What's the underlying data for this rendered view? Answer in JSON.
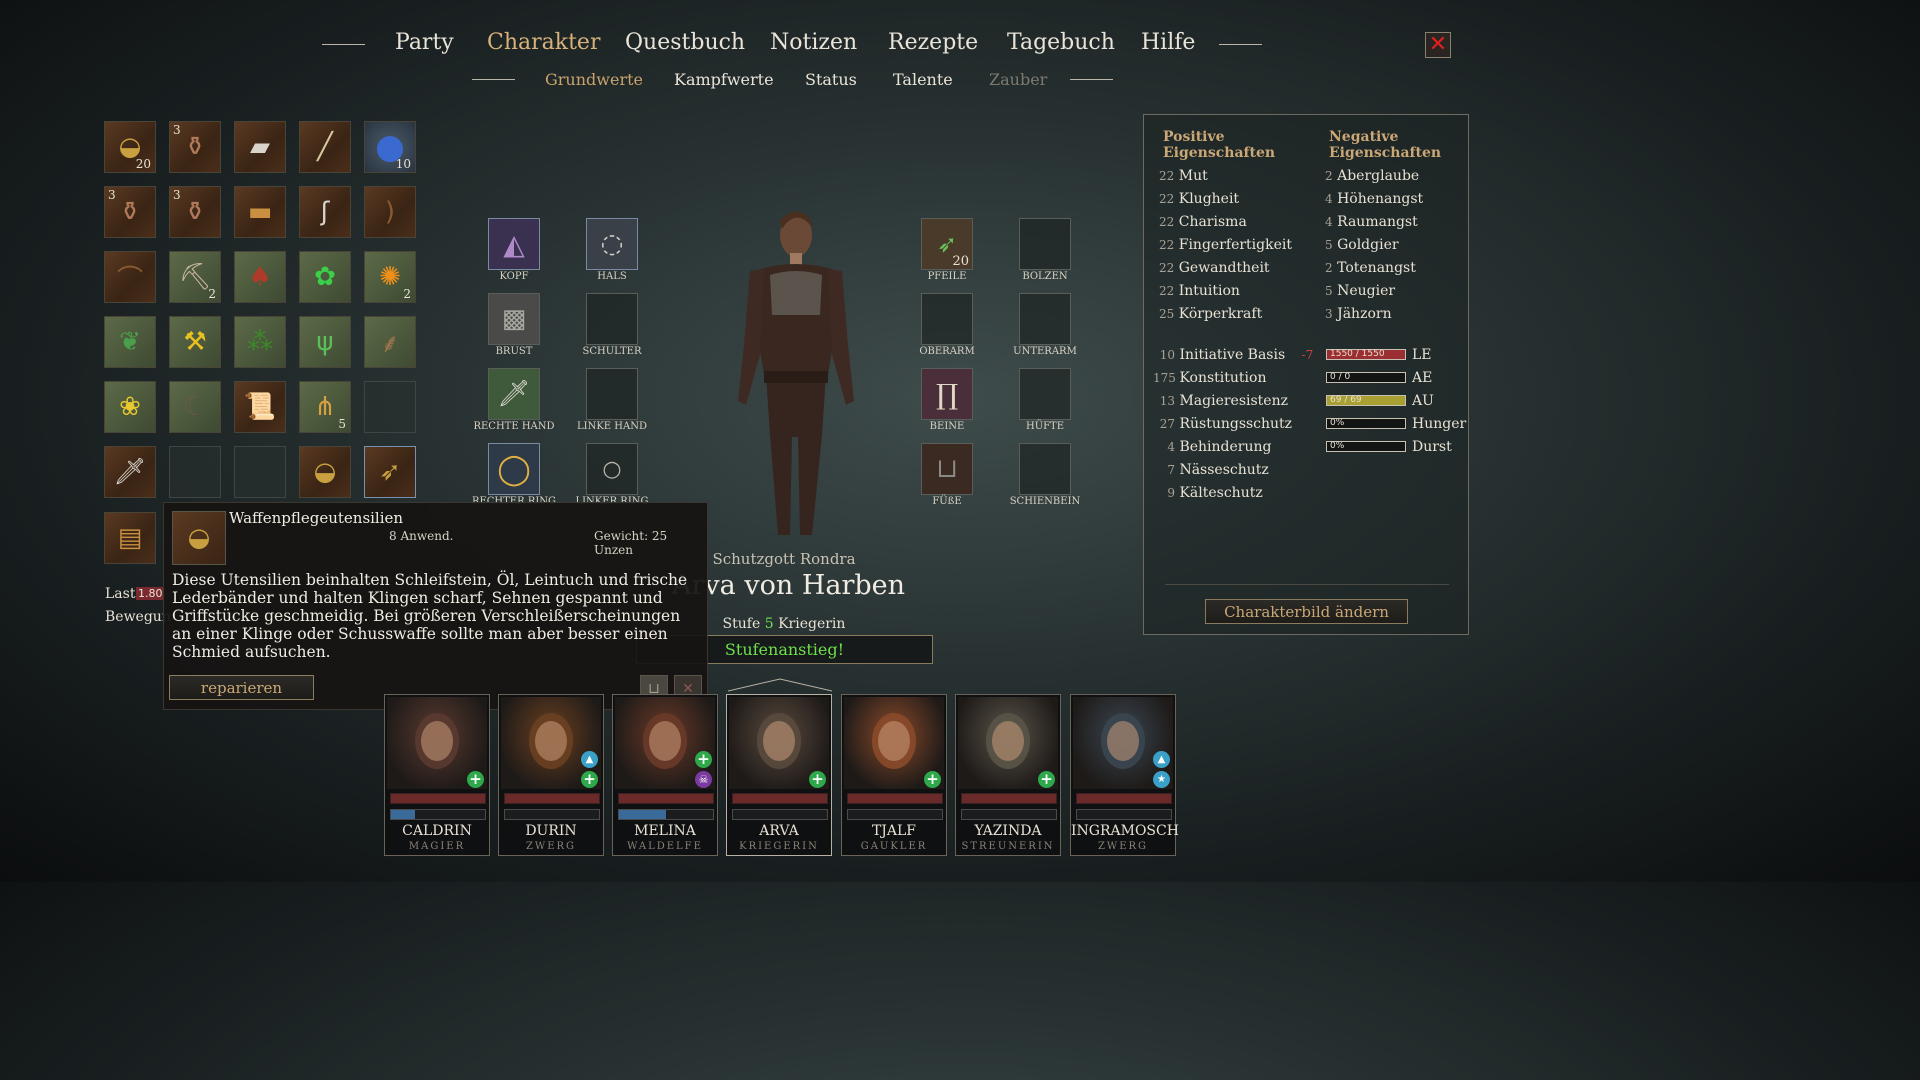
{
  "nav": {
    "tabs": [
      {
        "label": "Party"
      },
      {
        "label": "Charakter"
      },
      {
        "label": "Questbuch"
      },
      {
        "label": "Notizen"
      },
      {
        "label": "Rezepte"
      },
      {
        "label": "Tagebuch"
      },
      {
        "label": "Hilfe"
      }
    ],
    "subtabs": [
      {
        "label": "Grundwerte"
      },
      {
        "label": "Kampfwerte"
      },
      {
        "label": "Status"
      },
      {
        "label": "Talente"
      },
      {
        "label": "Zauber"
      }
    ],
    "close_glyph": "✕"
  },
  "inventory": {
    "counts": {
      "r0c0": "20",
      "r0c1": "3",
      "r0c4": "10",
      "r1c0": "3",
      "r1c1": "3",
      "r2c1": "2",
      "r2c4": "2",
      "r4c3": "5"
    },
    "last_label": "Last",
    "last_value": "1.80",
    "bewegung_label": "Bewegun"
  },
  "equipment": {
    "kopf": "KOPF",
    "hals": "HALS",
    "brust": "BRUST",
    "schulter": "SCHULTER",
    "rechte_hand": "RECHTE HAND",
    "linke_hand": "LINKE HAND",
    "rechter_ring": "RECHTER RING",
    "linker_ring": "LINKER RING",
    "pfeile": "PFEILE",
    "pfeile_count": "20",
    "bolzen": "BOLZEN",
    "oberarm": "OBERARM",
    "unterarm": "UNTERARM",
    "beine": "BEINE",
    "huefte": "HÜFTE",
    "fuesse": "FÜßE",
    "schienbein": "SCHIENBEIN"
  },
  "character": {
    "god": "Schutzgott Rondra",
    "name": "Arva von Harben",
    "level_prefix": "Stufe",
    "level": "5",
    "class": "Kriegerin",
    "levelup": "Stufenanstieg!"
  },
  "stats": {
    "positive_title_1": "Positive",
    "positive_title_2": "Eigenschaften",
    "negative_title_1": "Negative",
    "negative_title_2": "Eigenschaften",
    "positive": [
      {
        "value": "22",
        "label": "Mut"
      },
      {
        "value": "22",
        "label": "Klugheit"
      },
      {
        "value": "22",
        "label": "Charisma"
      },
      {
        "value": "22",
        "label": "Fingerfertigkeit"
      },
      {
        "value": "22",
        "label": "Gewandtheit"
      },
      {
        "value": "22",
        "label": "Intuition"
      },
      {
        "value": "25",
        "label": "Körperkraft"
      }
    ],
    "negative": [
      {
        "value": "2",
        "label": "Aberglaube"
      },
      {
        "value": "4",
        "label": "Höhenangst"
      },
      {
        "value": "4",
        "label": "Raumangst"
      },
      {
        "value": "5",
        "label": "Goldgier"
      },
      {
        "value": "2",
        "label": "Totenangst"
      },
      {
        "value": "5",
        "label": "Neugier"
      },
      {
        "value": "3",
        "label": "Jähzorn"
      }
    ],
    "derived": [
      {
        "value": "10",
        "label": "Initiative Basis",
        "mod": "-7"
      },
      {
        "value": "175",
        "label": "Konstitution"
      },
      {
        "value": "13",
        "label": "Magieresistenz"
      },
      {
        "value": "27",
        "label": "Rüstungsschutz"
      },
      {
        "value": "4",
        "label": "Behinderung"
      },
      {
        "value": "7",
        "label": "Nässeschutz"
      },
      {
        "value": "9",
        "label": "Kälteschutz"
      }
    ],
    "bars": [
      {
        "text": "1550 / 1550",
        "label": "LE",
        "fill": 1.0,
        "color": "#9a2e32"
      },
      {
        "text": "0 / 0",
        "label": "AE",
        "fill": 0.0,
        "color": "#3a6a9a"
      },
      {
        "text": "69 / 69",
        "label": "AU",
        "fill": 1.0,
        "color": "#a8a032"
      },
      {
        "text": "0%",
        "label": "Hunger",
        "fill": 0.0,
        "color": "#9a6a32"
      },
      {
        "text": "0%",
        "label": "Durst",
        "fill": 0.0,
        "color": "#3a7a9a"
      }
    ],
    "change_portrait": "Charakterbild ändern"
  },
  "tooltip": {
    "title": "Waffenpflegeutensilien",
    "uses": "8 Anwend.",
    "weight": "Gewicht: 25 Unzen",
    "description": "Diese Utensilien beinhalten Schleifstein, Öl, Leintuch und frische Lederbänder und halten Klingen scharf, Sehnen gespannt und Griffstücke geschmeidig. Bei größeren Verschleißerscheinungen an einer Klinge oder Schusswaffe sollte man aber besser einen Schmied aufsuchen.",
    "repair_button": "reparieren"
  },
  "party": [
    {
      "name": "CALDRIN",
      "cls": "MAGIER",
      "ae_fill": 0.25,
      "color": "#5a3a30",
      "badges": [
        "heal"
      ]
    },
    {
      "name": "DURIN",
      "cls": "ZWERG",
      "ae_fill": 0.0,
      "color": "#6a4020",
      "badges": [
        "bless",
        "heal"
      ]
    },
    {
      "name": "MELINA",
      "cls": "WALDELFE",
      "ae_fill": 0.5,
      "color": "#6a3a28",
      "badges": [
        "heal",
        "skull"
      ]
    },
    {
      "name": "ARVA",
      "cls": "KRIEGERIN",
      "ae_fill": 0.0,
      "color": "#5a4a3e",
      "badges": [
        "heal"
      ]
    },
    {
      "name": "TJALF",
      "cls": "GAUKLER",
      "ae_fill": 0.0,
      "color": "#8a4a2a",
      "badges": [
        "heal"
      ]
    },
    {
      "name": "YAZINDA",
      "cls": "STREUNERIN",
      "ae_fill": 0.0,
      "color": "#5a5448",
      "badges": [
        "heal"
      ]
    },
    {
      "name": "INGRAMOSCH",
      "cls": "ZWERG",
      "ae_fill": 0.0,
      "color": "#3a4650",
      "badges": [
        "bless",
        "star"
      ]
    }
  ],
  "colors": {
    "accent_gold": "#c9a776",
    "levelup_green": "#6ee04a",
    "close_red": "#e02020",
    "negative_red": "#d04040"
  }
}
